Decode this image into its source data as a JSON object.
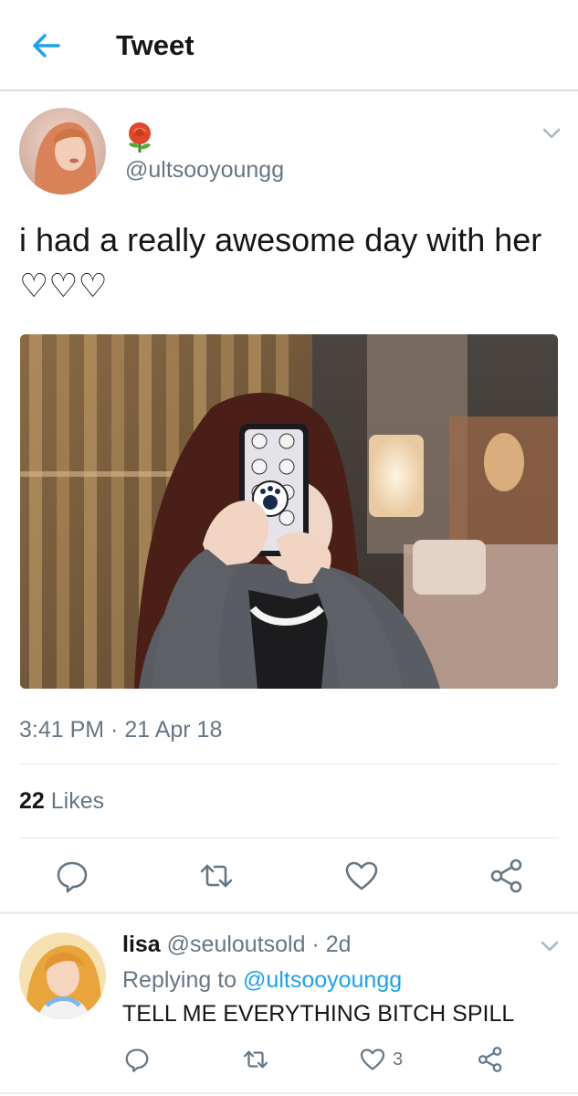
{
  "header": {
    "title": "Tweet",
    "back_icon": "arrow-left-icon"
  },
  "tweet": {
    "display_name_icon": "rose-emoji",
    "handle": "@ultsooyoungg",
    "text": "i had a really awesome day with her ♡♡♡",
    "time": "3:41 PM · 21 Apr 18",
    "likes_count": "22",
    "likes_label": "Likes",
    "photo_alt": "photo"
  },
  "reply": {
    "name": "lisa",
    "handle_time": "@seuloutsold · 2d",
    "replying_prefix": "Replying to",
    "replying_to": "@ultsooyoungg",
    "text": "TELL ME EVERYTHING BITCH SPILL",
    "like_count": "3"
  },
  "colors": {
    "accent": "#1da1f2",
    "muted": "#657786",
    "text": "#14171a",
    "divider": "#e1e8ed"
  }
}
